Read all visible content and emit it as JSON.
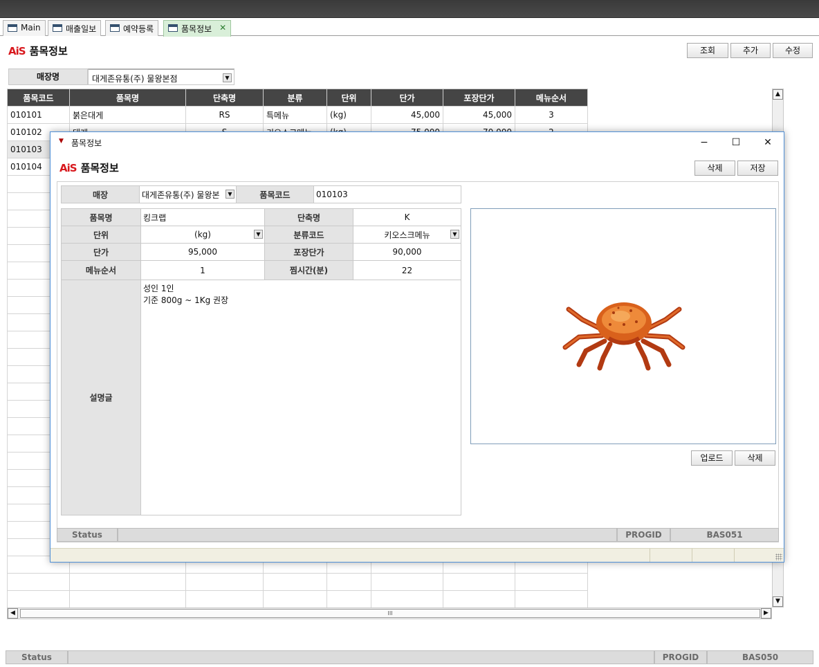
{
  "tabs": [
    {
      "label": "Main",
      "active": false
    },
    {
      "label": "매출일보",
      "active": false
    },
    {
      "label": "예약등록",
      "active": false
    },
    {
      "label": "품목정보",
      "active": true
    }
  ],
  "tab_close_symbol": "✕",
  "page": {
    "logo": "AiS",
    "title": "품목정보",
    "buttons": {
      "search": "조회",
      "add": "추가",
      "edit": "수정"
    },
    "filter": {
      "label": "매장명",
      "value": "대게존유통(주) 물왕본점"
    },
    "grid": {
      "columns": [
        "품목코드",
        "품목명",
        "단축명",
        "분류",
        "단위",
        "단가",
        "포장단가",
        "메뉴순서"
      ],
      "rows": [
        [
          "010101",
          "붉은대게",
          "RS",
          "특메뉴",
          "(kg)",
          "45,000",
          "45,000",
          "3"
        ],
        [
          "010102",
          "대게",
          "S",
          "키오스크메뉴",
          "(kg)",
          "75,000",
          "70,000",
          "2"
        ],
        [
          "010103",
          "",
          "",
          "",
          "",
          "",
          "",
          ""
        ],
        [
          "010104",
          "",
          "",
          "",
          "",
          "",
          "",
          ""
        ]
      ]
    },
    "scroll_thumb": "III",
    "status": {
      "label": "Status",
      "text": "",
      "progid_label": "PROGID",
      "progid": "BAS050"
    }
  },
  "dialog": {
    "window_title": "품목정보",
    "logo": "AiS",
    "title": "품목정보",
    "buttons": {
      "delete": "삭제",
      "save": "저장",
      "upload": "업로드",
      "image_delete": "삭제"
    },
    "store": {
      "label": "매장",
      "value": "대게존유통(주) 물왕본"
    },
    "code": {
      "label": "품목코드",
      "value": "010103"
    },
    "fields": {
      "name_label": "품목명",
      "name": "킹크랩",
      "short_label": "단축명",
      "short": "K",
      "unit_label": "단위",
      "unit": "(kg)",
      "category_label": "분류코드",
      "category": "키오스크메뉴",
      "price_label": "단가",
      "price": "95,000",
      "pack_price_label": "포장단가",
      "pack_price": "90,000",
      "menu_order_label": "메뉴순서",
      "menu_order": "1",
      "steam_time_label": "찜시간(분)",
      "steam_time": "22",
      "desc_label": "설명글",
      "desc_line1": "성인 1인",
      "desc_line2": "기준 800g ~ 1Kg 권장"
    },
    "status": {
      "label": "Status",
      "text": "",
      "progid_label": "PROGID",
      "progid": "BAS051"
    }
  }
}
